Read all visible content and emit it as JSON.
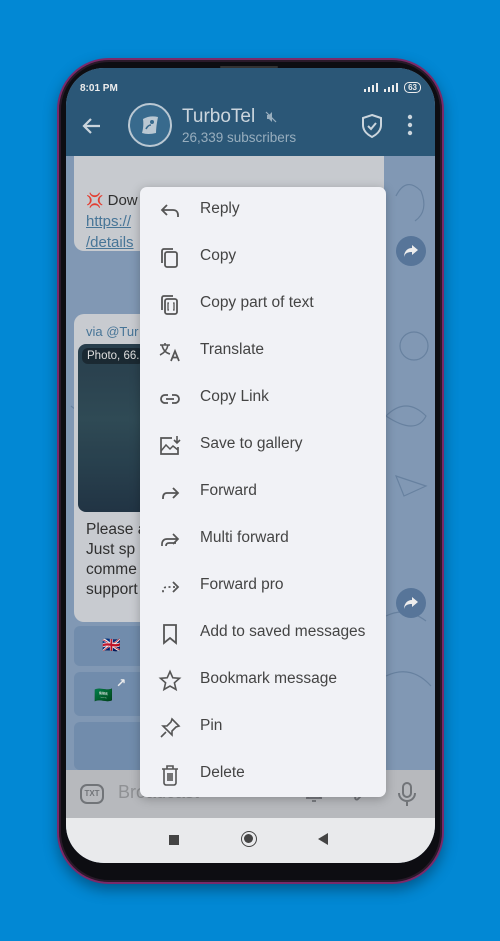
{
  "status_bar": {
    "time": "8:01 PM",
    "network": "4G",
    "battery": "63"
  },
  "header": {
    "title": "TurboTel",
    "subtitle": "26,339 subscribers"
  },
  "chat": {
    "message1": {
      "emoji": "💢",
      "text_visible": "Dow",
      "link_line1": "https://",
      "link_line2": "/details"
    },
    "message2": {
      "via": "via @Tur",
      "photo_label": "Photo, 66.",
      "text_lines": [
        "Please a",
        "Just sp",
        "comme",
        "support"
      ]
    },
    "inline_keyboard": [
      {
        "flag": "🇬🇧"
      },
      {
        "flag": "🇸🇦",
        "link_arrow": "↗"
      }
    ]
  },
  "input": {
    "placeholder": "Broadcast",
    "mode_badge": "TXT"
  },
  "context_menu": {
    "items": [
      {
        "label": "Reply",
        "icon": "reply-icon"
      },
      {
        "label": "Copy",
        "icon": "copy-icon"
      },
      {
        "label": "Copy part of text",
        "icon": "copy-part-icon"
      },
      {
        "label": "Translate",
        "icon": "translate-icon"
      },
      {
        "label": "Copy Link",
        "icon": "link-icon"
      },
      {
        "label": "Save to gallery",
        "icon": "save-gallery-icon"
      },
      {
        "label": "Forward",
        "icon": "forward-icon"
      },
      {
        "label": "Multi forward",
        "icon": "multi-forward-icon"
      },
      {
        "label": "Forward pro",
        "icon": "forward-pro-icon"
      },
      {
        "label": "Add to saved messages",
        "icon": "bookmark-outline-icon"
      },
      {
        "label": "Bookmark message",
        "icon": "star-icon"
      },
      {
        "label": "Pin",
        "icon": "pin-icon"
      },
      {
        "label": "Delete",
        "icon": "trash-icon"
      }
    ]
  },
  "colors": {
    "background": "#0288d4",
    "header": "#2f5e80",
    "menu": "#f1f2f6",
    "link": "#4d7ea3"
  }
}
